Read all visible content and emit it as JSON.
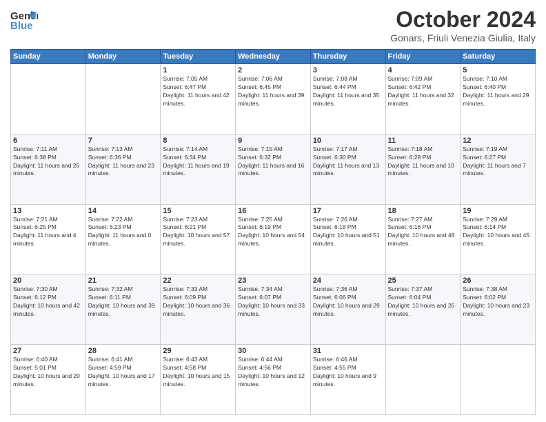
{
  "logo": {
    "text_general": "General",
    "text_blue": "Blue"
  },
  "header": {
    "month": "October 2024",
    "location": "Gonars, Friuli Venezia Giulia, Italy"
  },
  "weekdays": [
    "Sunday",
    "Monday",
    "Tuesday",
    "Wednesday",
    "Thursday",
    "Friday",
    "Saturday"
  ],
  "weeks": [
    [
      {
        "day": "",
        "sunrise": "",
        "sunset": "",
        "daylight": ""
      },
      {
        "day": "",
        "sunrise": "",
        "sunset": "",
        "daylight": ""
      },
      {
        "day": "1",
        "sunrise": "Sunrise: 7:05 AM",
        "sunset": "Sunset: 6:47 PM",
        "daylight": "Daylight: 11 hours and 42 minutes."
      },
      {
        "day": "2",
        "sunrise": "Sunrise: 7:06 AM",
        "sunset": "Sunset: 6:45 PM",
        "daylight": "Daylight: 11 hours and 39 minutes."
      },
      {
        "day": "3",
        "sunrise": "Sunrise: 7:08 AM",
        "sunset": "Sunset: 6:44 PM",
        "daylight": "Daylight: 11 hours and 35 minutes."
      },
      {
        "day": "4",
        "sunrise": "Sunrise: 7:09 AM",
        "sunset": "Sunset: 6:42 PM",
        "daylight": "Daylight: 11 hours and 32 minutes."
      },
      {
        "day": "5",
        "sunrise": "Sunrise: 7:10 AM",
        "sunset": "Sunset: 6:40 PM",
        "daylight": "Daylight: 11 hours and 29 minutes."
      }
    ],
    [
      {
        "day": "6",
        "sunrise": "Sunrise: 7:11 AM",
        "sunset": "Sunset: 6:38 PM",
        "daylight": "Daylight: 11 hours and 26 minutes."
      },
      {
        "day": "7",
        "sunrise": "Sunrise: 7:13 AM",
        "sunset": "Sunset: 6:36 PM",
        "daylight": "Daylight: 11 hours and 23 minutes."
      },
      {
        "day": "8",
        "sunrise": "Sunrise: 7:14 AM",
        "sunset": "Sunset: 6:34 PM",
        "daylight": "Daylight: 11 hours and 19 minutes."
      },
      {
        "day": "9",
        "sunrise": "Sunrise: 7:15 AM",
        "sunset": "Sunset: 6:32 PM",
        "daylight": "Daylight: 11 hours and 16 minutes."
      },
      {
        "day": "10",
        "sunrise": "Sunrise: 7:17 AM",
        "sunset": "Sunset: 6:30 PM",
        "daylight": "Daylight: 11 hours and 13 minutes."
      },
      {
        "day": "11",
        "sunrise": "Sunrise: 7:18 AM",
        "sunset": "Sunset: 6:28 PM",
        "daylight": "Daylight: 11 hours and 10 minutes."
      },
      {
        "day": "12",
        "sunrise": "Sunrise: 7:19 AM",
        "sunset": "Sunset: 6:27 PM",
        "daylight": "Daylight: 11 hours and 7 minutes."
      }
    ],
    [
      {
        "day": "13",
        "sunrise": "Sunrise: 7:21 AM",
        "sunset": "Sunset: 6:25 PM",
        "daylight": "Daylight: 11 hours and 4 minutes."
      },
      {
        "day": "14",
        "sunrise": "Sunrise: 7:22 AM",
        "sunset": "Sunset: 6:23 PM",
        "daylight": "Daylight: 11 hours and 0 minutes."
      },
      {
        "day": "15",
        "sunrise": "Sunrise: 7:23 AM",
        "sunset": "Sunset: 6:21 PM",
        "daylight": "Daylight: 10 hours and 57 minutes."
      },
      {
        "day": "16",
        "sunrise": "Sunrise: 7:25 AM",
        "sunset": "Sunset: 6:19 PM",
        "daylight": "Daylight: 10 hours and 54 minutes."
      },
      {
        "day": "17",
        "sunrise": "Sunrise: 7:26 AM",
        "sunset": "Sunset: 6:18 PM",
        "daylight": "Daylight: 10 hours and 51 minutes."
      },
      {
        "day": "18",
        "sunrise": "Sunrise: 7:27 AM",
        "sunset": "Sunset: 6:16 PM",
        "daylight": "Daylight: 10 hours and 48 minutes."
      },
      {
        "day": "19",
        "sunrise": "Sunrise: 7:29 AM",
        "sunset": "Sunset: 6:14 PM",
        "daylight": "Daylight: 10 hours and 45 minutes."
      }
    ],
    [
      {
        "day": "20",
        "sunrise": "Sunrise: 7:30 AM",
        "sunset": "Sunset: 6:12 PM",
        "daylight": "Daylight: 10 hours and 42 minutes."
      },
      {
        "day": "21",
        "sunrise": "Sunrise: 7:32 AM",
        "sunset": "Sunset: 6:11 PM",
        "daylight": "Daylight: 10 hours and 39 minutes."
      },
      {
        "day": "22",
        "sunrise": "Sunrise: 7:33 AM",
        "sunset": "Sunset: 6:09 PM",
        "daylight": "Daylight: 10 hours and 36 minutes."
      },
      {
        "day": "23",
        "sunrise": "Sunrise: 7:34 AM",
        "sunset": "Sunset: 6:07 PM",
        "daylight": "Daylight: 10 hours and 33 minutes."
      },
      {
        "day": "24",
        "sunrise": "Sunrise: 7:36 AM",
        "sunset": "Sunset: 6:06 PM",
        "daylight": "Daylight: 10 hours and 29 minutes."
      },
      {
        "day": "25",
        "sunrise": "Sunrise: 7:37 AM",
        "sunset": "Sunset: 6:04 PM",
        "daylight": "Daylight: 10 hours and 26 minutes."
      },
      {
        "day": "26",
        "sunrise": "Sunrise: 7:38 AM",
        "sunset": "Sunset: 6:02 PM",
        "daylight": "Daylight: 10 hours and 23 minutes."
      }
    ],
    [
      {
        "day": "27",
        "sunrise": "Sunrise: 6:40 AM",
        "sunset": "Sunset: 5:01 PM",
        "daylight": "Daylight: 10 hours and 20 minutes."
      },
      {
        "day": "28",
        "sunrise": "Sunrise: 6:41 AM",
        "sunset": "Sunset: 4:59 PM",
        "daylight": "Daylight: 10 hours and 17 minutes."
      },
      {
        "day": "29",
        "sunrise": "Sunrise: 6:43 AM",
        "sunset": "Sunset: 4:58 PM",
        "daylight": "Daylight: 10 hours and 15 minutes."
      },
      {
        "day": "30",
        "sunrise": "Sunrise: 6:44 AM",
        "sunset": "Sunset: 4:56 PM",
        "daylight": "Daylight: 10 hours and 12 minutes."
      },
      {
        "day": "31",
        "sunrise": "Sunrise: 6:46 AM",
        "sunset": "Sunset: 4:55 PM",
        "daylight": "Daylight: 10 hours and 9 minutes."
      },
      {
        "day": "",
        "sunrise": "",
        "sunset": "",
        "daylight": ""
      },
      {
        "day": "",
        "sunrise": "",
        "sunset": "",
        "daylight": ""
      }
    ]
  ]
}
